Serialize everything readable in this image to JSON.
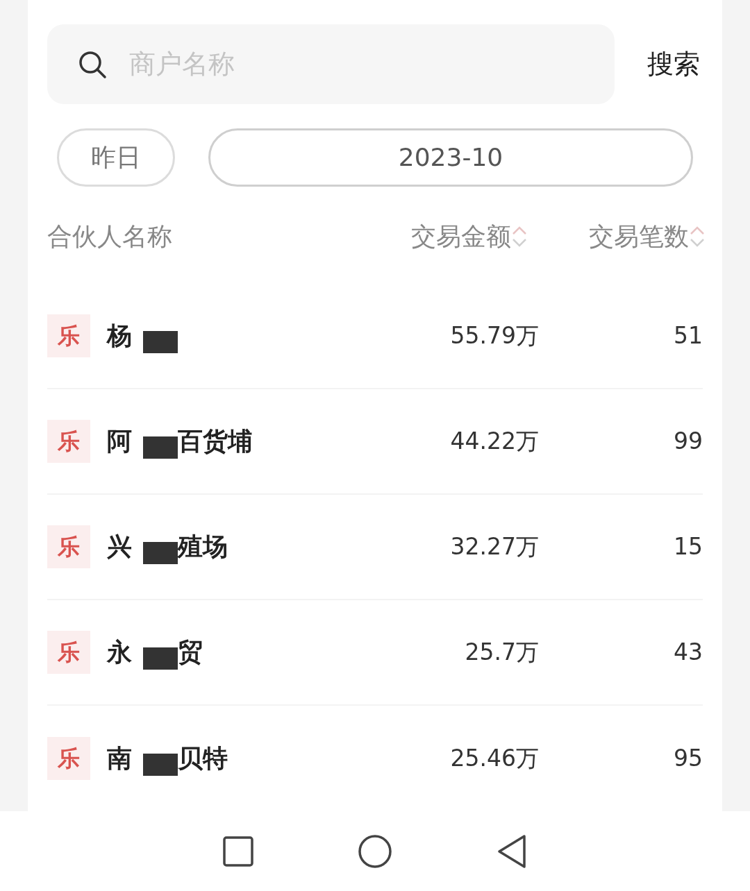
{
  "search": {
    "placeholder": "商户名称",
    "button": "搜索"
  },
  "date_filters": [
    {
      "label": "昨日",
      "selected": false
    },
    {
      "label": "2023-10",
      "selected": true
    }
  ],
  "table": {
    "columns": [
      {
        "label": "合伙人名称",
        "kind": "plain"
      },
      {
        "label": "交易金额",
        "kind": "sortable"
      },
      {
        "label": "交易笔数",
        "kind": "sortable"
      }
    ],
    "rows": [
      {
        "badge": "乐",
        "name_start": "杨",
        "name_end": "",
        "amount": "55.79万",
        "count": "51"
      },
      {
        "badge": "乐",
        "name_start": "阿",
        "name_end": "百货埔",
        "amount": "44.22万",
        "count": "99"
      },
      {
        "badge": "乐",
        "name_start": "兴",
        "name_end": "殖场",
        "amount": "32.27万",
        "count": "15"
      },
      {
        "badge": "乐",
        "name_start": "永",
        "name_end": "贸",
        "amount": "25.7万",
        "count": "43"
      },
      {
        "badge": "乐",
        "name_start": "南",
        "name_end": "贝特",
        "amount": "25.46万",
        "count": "95"
      }
    ]
  }
}
